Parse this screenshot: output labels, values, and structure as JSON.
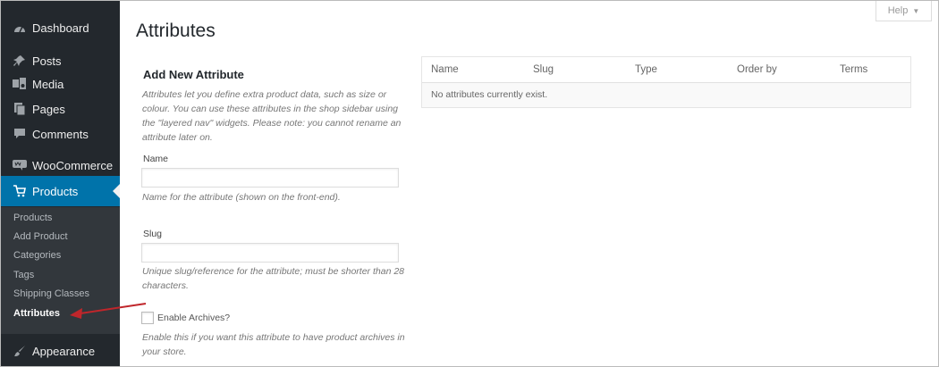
{
  "sidebar": {
    "items": [
      {
        "label": "Dashboard",
        "icon": "dashboard-icon"
      },
      {
        "label": "Posts",
        "icon": "pin-icon"
      },
      {
        "label": "Media",
        "icon": "media-icon"
      },
      {
        "label": "Pages",
        "icon": "pages-icon"
      },
      {
        "label": "Comments",
        "icon": "comments-icon"
      },
      {
        "label": "WooCommerce",
        "icon": "woocommerce-icon"
      },
      {
        "label": "Products",
        "icon": "cart-icon"
      },
      {
        "label": "Appearance",
        "icon": "brush-icon"
      }
    ],
    "submenu": [
      "Products",
      "Add Product",
      "Categories",
      "Tags",
      "Shipping Classes",
      "Attributes"
    ],
    "colors": {
      "background": "#23282d",
      "active": "#0073aa",
      "submenu": "#32373c"
    }
  },
  "header": {
    "title": "Attributes",
    "help_label": "Help"
  },
  "form": {
    "title": "Add New Attribute",
    "intro": "Attributes let you define extra product data, such as size or colour. You can use these attributes in the shop sidebar using the \"layered nav\" widgets. Please note: you cannot rename an attribute later on.",
    "name_label": "Name",
    "name_value": "",
    "name_desc": "Name for the attribute (shown on the front-end).",
    "slug_label": "Slug",
    "slug_value": "",
    "slug_desc": "Unique slug/reference for the attribute; must be shorter than 28 characters.",
    "archives_label": "Enable Archives?",
    "archives_checked": false,
    "archives_desc": "Enable this if you want this attribute to have product archives in your store."
  },
  "table": {
    "columns": [
      "Name",
      "Slug",
      "Type",
      "Order by",
      "Terms"
    ],
    "empty_message": "No attributes currently exist."
  },
  "annotation": {
    "arrow_color": "#c0262b"
  }
}
